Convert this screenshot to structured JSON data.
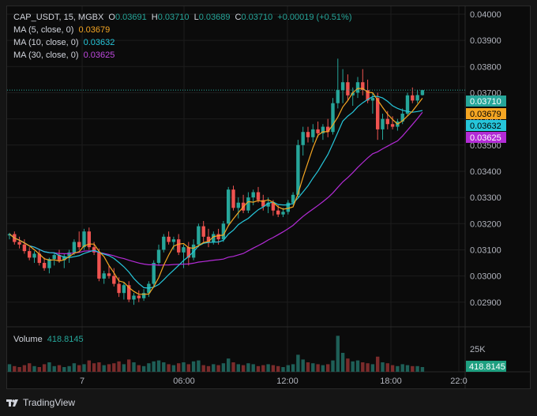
{
  "header": {
    "symbol": "CAP_USDT, 15, MGBX",
    "open_label": "O",
    "open": "0.03691",
    "high_label": "H",
    "high": "0.03710",
    "low_label": "L",
    "low": "0.03689",
    "close_label": "C",
    "close": "0.03710",
    "change": "+0.00019 (+0.51%)"
  },
  "indicators": [
    {
      "label": "MA (5, close, 0)",
      "value": "0.03679",
      "color": "#f5a623"
    },
    {
      "label": "MA (10, close, 0)",
      "value": "0.03632",
      "color": "#26c6da"
    },
    {
      "label": "MA (30, close, 0)",
      "value": "0.03625",
      "color": "#b32bd6"
    }
  ],
  "volume_pane": {
    "label": "Volume",
    "value": "418.8145",
    "axis_tick": "25K"
  },
  "price_tag": "0.03710",
  "branding": "TradingView",
  "colors": {
    "up": "#26a69a",
    "down": "#ef5350",
    "ma5": "#f5a623",
    "ma10": "#26c6da",
    "ma30": "#b32bd6"
  },
  "chart_data": {
    "type": "candlestick",
    "price_axis": {
      "ticks": [
        "0.04000",
        "0.03900",
        "0.03800",
        "0.03700",
        "0.03600",
        "0.03500",
        "0.03400",
        "0.03300",
        "0.03200",
        "0.03100",
        "0.03000",
        "0.02900"
      ],
      "ylim": [
        0.0283,
        0.0403
      ]
    },
    "time_axis": {
      "ticks": [
        "7",
        "06:00",
        "12:00",
        "18:00",
        "22:0"
      ]
    },
    "candles": [
      [
        0.03155,
        0.03165,
        0.0314,
        0.0316
      ],
      [
        0.0316,
        0.0317,
        0.0312,
        0.0313
      ],
      [
        0.0313,
        0.0315,
        0.03105,
        0.0312
      ],
      [
        0.0312,
        0.0314,
        0.03085,
        0.03095
      ],
      [
        0.03095,
        0.0311,
        0.0306,
        0.0307
      ],
      [
        0.0307,
        0.03095,
        0.0305,
        0.03085
      ],
      [
        0.03085,
        0.031,
        0.0304,
        0.0305
      ],
      [
        0.0305,
        0.0307,
        0.0302,
        0.0303
      ],
      [
        0.0303,
        0.0307,
        0.0301,
        0.03065
      ],
      [
        0.03065,
        0.0309,
        0.0304,
        0.0308
      ],
      [
        0.0308,
        0.031,
        0.0305,
        0.0306
      ],
      [
        0.0306,
        0.03085,
        0.0303,
        0.03075
      ],
      [
        0.03075,
        0.031,
        0.0305,
        0.0309
      ],
      [
        0.0309,
        0.0314,
        0.0308,
        0.0313
      ],
      [
        0.0313,
        0.0317,
        0.031,
        0.0311
      ],
      [
        0.0311,
        0.0318,
        0.031,
        0.0317
      ],
      [
        0.0317,
        0.03185,
        0.031,
        0.0311
      ],
      [
        0.0311,
        0.0313,
        0.0308,
        0.0309
      ],
      [
        0.0309,
        0.03105,
        0.0298,
        0.0299
      ],
      [
        0.0299,
        0.0302,
        0.0297,
        0.0301
      ],
      [
        0.0301,
        0.0304,
        0.0299,
        0.03
      ],
      [
        0.03,
        0.0303,
        0.0296,
        0.0297
      ],
      [
        0.0297,
        0.02995,
        0.0292,
        0.02935
      ],
      [
        0.02935,
        0.02975,
        0.0291,
        0.02965
      ],
      [
        0.02965,
        0.0298,
        0.029,
        0.0291
      ],
      [
        0.0291,
        0.02935,
        0.0289,
        0.02925
      ],
      [
        0.02925,
        0.02945,
        0.029,
        0.02915
      ],
      [
        0.02915,
        0.0295,
        0.02905,
        0.02935
      ],
      [
        0.02935,
        0.0298,
        0.0292,
        0.0297
      ],
      [
        0.0297,
        0.0306,
        0.0296,
        0.0305
      ],
      [
        0.0305,
        0.0312,
        0.0304,
        0.031
      ],
      [
        0.031,
        0.0316,
        0.0309,
        0.0315
      ],
      [
        0.0315,
        0.0317,
        0.0312,
        0.0313
      ],
      [
        0.0313,
        0.0315,
        0.031,
        0.0314
      ],
      [
        0.0314,
        0.0316,
        0.0308,
        0.0309
      ],
      [
        0.0309,
        0.0312,
        0.0303,
        0.0311
      ],
      [
        0.0311,
        0.0313,
        0.0304,
        0.0307
      ],
      [
        0.0307,
        0.0314,
        0.0306,
        0.0312
      ],
      [
        0.0312,
        0.032,
        0.0311,
        0.0319
      ],
      [
        0.0319,
        0.0321,
        0.0313,
        0.0315
      ],
      [
        0.0315,
        0.0318,
        0.0311,
        0.0313
      ],
      [
        0.0313,
        0.0317,
        0.0312,
        0.0316
      ],
      [
        0.0316,
        0.0318,
        0.0312,
        0.0314
      ],
      [
        0.0314,
        0.0321,
        0.0313,
        0.032
      ],
      [
        0.032,
        0.0334,
        0.0319,
        0.0333
      ],
      [
        0.0333,
        0.03345,
        0.0325,
        0.0326
      ],
      [
        0.0326,
        0.033,
        0.0322,
        0.0328
      ],
      [
        0.0328,
        0.0331,
        0.0324,
        0.0325
      ],
      [
        0.0325,
        0.0332,
        0.0324,
        0.033
      ],
      [
        0.033,
        0.0333,
        0.0327,
        0.0332
      ],
      [
        0.0332,
        0.0334,
        0.0328,
        0.0329
      ],
      [
        0.0329,
        0.0331,
        0.0325,
        0.03265
      ],
      [
        0.03265,
        0.033,
        0.0324,
        0.0328
      ],
      [
        0.0328,
        0.0329,
        0.0323,
        0.0325
      ],
      [
        0.0325,
        0.0327,
        0.03225,
        0.03235
      ],
      [
        0.03235,
        0.0326,
        0.03225,
        0.03245
      ],
      [
        0.03245,
        0.0329,
        0.03235,
        0.0328
      ],
      [
        0.0328,
        0.0332,
        0.0327,
        0.0331
      ],
      [
        0.0331,
        0.0352,
        0.033,
        0.035
      ],
      [
        0.035,
        0.0357,
        0.0346,
        0.0355
      ],
      [
        0.0355,
        0.0357,
        0.0351,
        0.0353
      ],
      [
        0.0353,
        0.0358,
        0.0351,
        0.0356
      ],
      [
        0.0356,
        0.0359,
        0.0353,
        0.03545
      ],
      [
        0.03545,
        0.0358,
        0.0352,
        0.0357
      ],
      [
        0.0357,
        0.036,
        0.0353,
        0.0355
      ],
      [
        0.0355,
        0.0368,
        0.0354,
        0.0366
      ],
      [
        0.0366,
        0.0383,
        0.0364,
        0.0371
      ],
      [
        0.0371,
        0.0379,
        0.0366,
        0.0374
      ],
      [
        0.0374,
        0.0377,
        0.0367,
        0.0369
      ],
      [
        0.0369,
        0.0372,
        0.0365,
        0.037
      ],
      [
        0.037,
        0.0376,
        0.0368,
        0.0374
      ],
      [
        0.0374,
        0.0379,
        0.0369,
        0.0371
      ],
      [
        0.0371,
        0.0375,
        0.0366,
        0.0367
      ],
      [
        0.0367,
        0.037,
        0.0362,
        0.0368
      ],
      [
        0.0368,
        0.037,
        0.0352,
        0.0356
      ],
      [
        0.0356,
        0.0362,
        0.0352,
        0.036
      ],
      [
        0.036,
        0.0363,
        0.0356,
        0.0358
      ],
      [
        0.0358,
        0.0361,
        0.0356,
        0.0357
      ],
      [
        0.0357,
        0.036,
        0.03555,
        0.0359
      ],
      [
        0.0359,
        0.0364,
        0.0358,
        0.0362
      ],
      [
        0.0362,
        0.037,
        0.0361,
        0.0369
      ],
      [
        0.0369,
        0.0372,
        0.0366,
        0.0367
      ],
      [
        0.0367,
        0.0371,
        0.0366,
        0.03691
      ],
      [
        0.03691,
        0.0371,
        0.03689,
        0.0371
      ]
    ],
    "ma5_last": 0.03679,
    "ma10_last": 0.03632,
    "ma30_last": 0.03625,
    "volume": [
      8,
      6,
      5,
      7,
      9,
      6,
      5,
      8,
      10,
      6,
      7,
      5,
      6,
      9,
      7,
      8,
      12,
      9,
      10,
      7,
      8,
      9,
      11,
      8,
      13,
      10,
      7,
      6,
      9,
      11,
      12,
      10,
      8,
      7,
      9,
      10,
      8,
      11,
      12,
      7,
      6,
      8,
      7,
      9,
      14,
      10,
      8,
      7,
      9,
      8,
      6,
      7,
      8,
      7,
      6,
      5,
      7,
      8,
      18,
      13,
      10,
      9,
      8,
      7,
      8,
      12,
      38,
      20,
      14,
      11,
      12,
      10,
      9,
      8,
      16,
      10,
      9,
      7,
      6,
      8,
      7,
      6,
      6,
      5
    ]
  }
}
